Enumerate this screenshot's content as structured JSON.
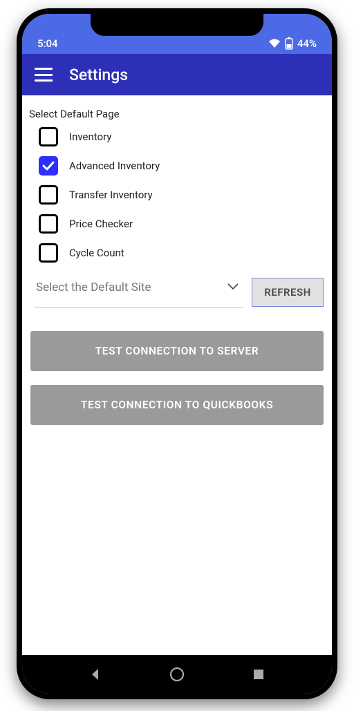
{
  "status": {
    "time": "5:04",
    "battery": "44%"
  },
  "header": {
    "title": "Settings"
  },
  "section": {
    "label": "Select Default Page"
  },
  "options": {
    "inventory": "Inventory",
    "advanced_inventory": "Advanced Inventory",
    "transfer_inventory": "Transfer Inventory",
    "price_checker": "Price Checker",
    "cycle_count": "Cycle Count"
  },
  "site": {
    "placeholder": "Select the Default Site",
    "refresh": "REFRESH"
  },
  "buttons": {
    "test_server": "TEST CONNECTION TO SERVER",
    "test_quickbooks": "TEST CONNECTION TO QUICKBOOKS"
  },
  "colors": {
    "primary": "#2e2fb7",
    "status_bar": "#4c6ae6",
    "check_accent": "#2e2fff",
    "btn_gray": "#9a9a9a"
  }
}
